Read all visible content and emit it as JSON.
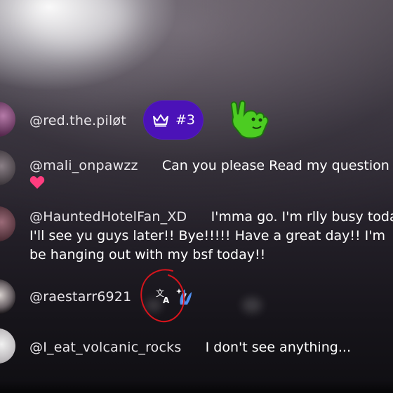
{
  "comments": [
    {
      "handle": "@red.the.piløt",
      "badge": {
        "label": "#3",
        "color": "#4b12b8",
        "icon": "crown-icon"
      },
      "sticker": "green-raised-hand-sticker"
    },
    {
      "handle": "@mali_onpawzz",
      "text": "Can you please Read my question",
      "emoji": [
        "pink-heart-icon",
        "pink-heart-icon"
      ]
    },
    {
      "handle": "@HauntedHotelFan_XD",
      "lines": [
        "I'mma go. I'm rlly busy toda",
        "I'll see yu guys later!! Bye!!!!! Have a great day!! I'm",
        "be hanging out with my bsf today!!"
      ]
    },
    {
      "handle": "@raestarr6921",
      "translate_icon": "translate-icon",
      "emoji": "wave-sparkle-icon",
      "annotation": "red-hand-drawn-circle"
    },
    {
      "handle": "@I_eat_volcanic_rocks",
      "text": "I don't see anything..."
    }
  ],
  "colors": {
    "badge": "#4b12b8",
    "heart": "#ff3d7f",
    "annotation": "#d8141c",
    "sticker": "#4ccc22"
  }
}
